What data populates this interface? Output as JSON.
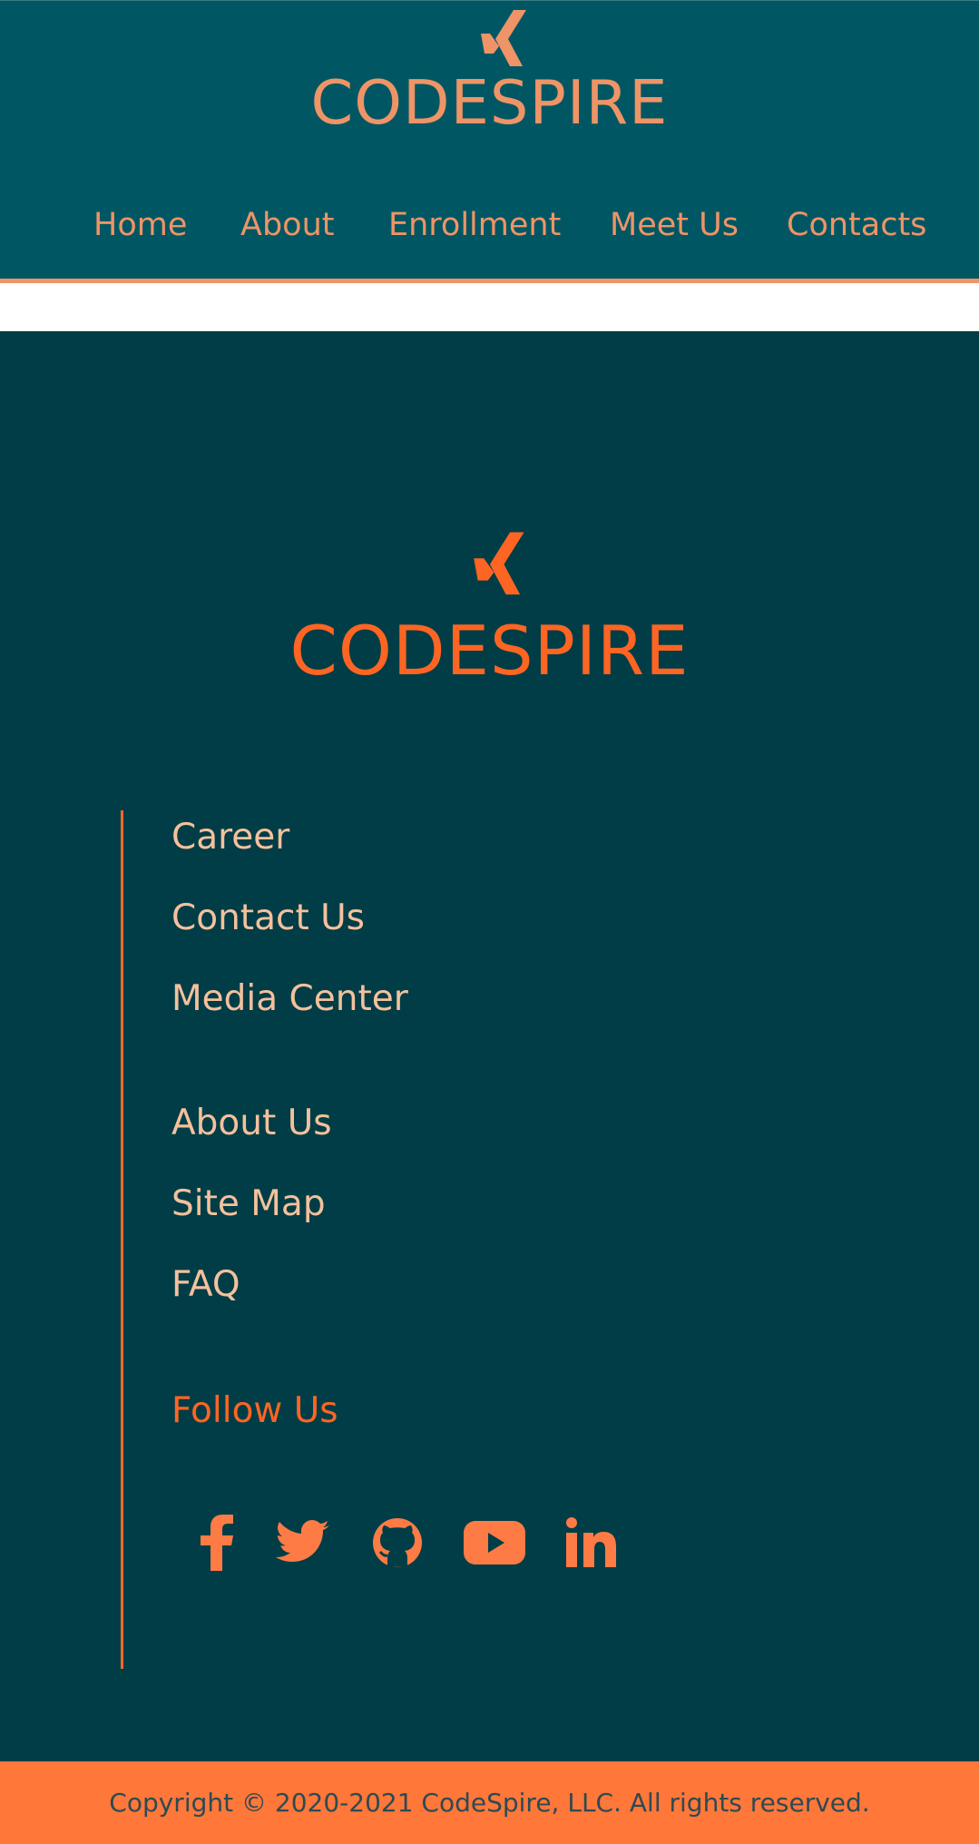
{
  "header": {
    "brand": "CODESPIRE",
    "nav": [
      {
        "label": "Home"
      },
      {
        "label": "About"
      },
      {
        "label": "Enrollment"
      },
      {
        "label": "Meet Us"
      },
      {
        "label": "Contacts"
      }
    ]
  },
  "footer": {
    "brand": "CODESPIRE",
    "links_group_1": [
      "Career",
      "Contact Us",
      "Media Center"
    ],
    "links_group_2": [
      "About Us",
      "Site Map",
      "FAQ"
    ],
    "follow_label": "Follow Us",
    "social": [
      {
        "icon": "facebook-icon"
      },
      {
        "icon": "twitter-icon"
      },
      {
        "icon": "github-icon"
      },
      {
        "icon": "youtube-icon"
      },
      {
        "icon": "linkedin-icon"
      }
    ],
    "copyright": "Copyright © 2020-2021 CodeSpire, LLC. All rights reserved."
  },
  "colors": {
    "header_bg": "#005763",
    "footer_bg": "#003d46",
    "accent": "#ff6522",
    "nav_text": "#ef9466",
    "link_text": "#f4c19d",
    "copyright_bg": "#ff7739"
  }
}
